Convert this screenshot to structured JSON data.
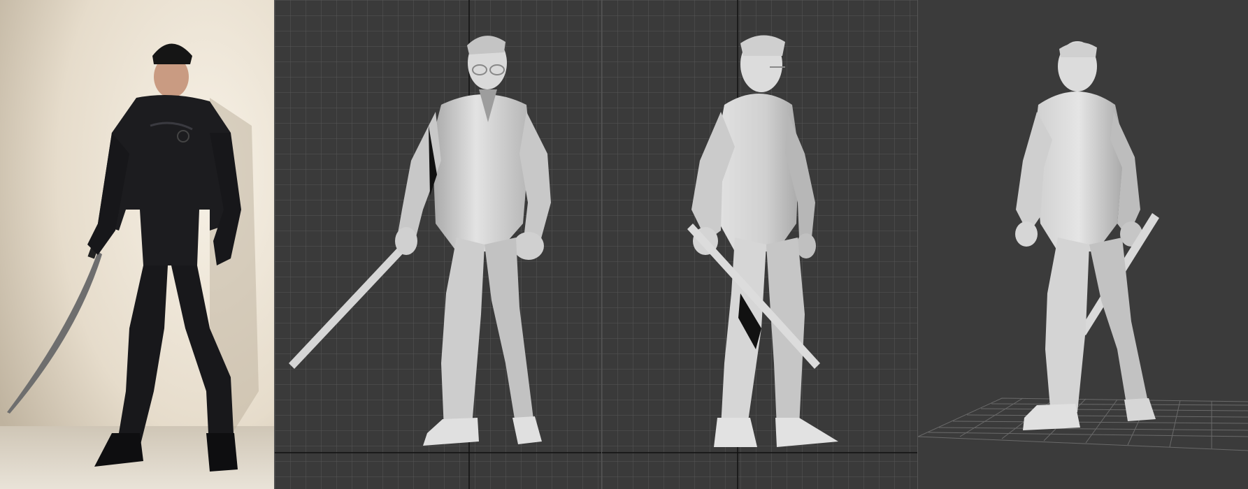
{
  "colors": {
    "viewport_bg": "#3a3a3a",
    "viewport_bg_persp": "#3b3b3b",
    "grid_line": "#575757",
    "grid_axis": "#101010",
    "model_light": "#d9d9d9",
    "model_mid": "#b8b8b8",
    "model_shadow": "#8a8a8a",
    "photo_wall": "#e9e0cf",
    "photo_floor": "#d8d0c2",
    "leather": "#1a1a1c"
  },
  "viewports": [
    {
      "name": "reference-photo"
    },
    {
      "name": "front-viewport"
    },
    {
      "name": "side-viewport"
    },
    {
      "name": "perspective-viewport"
    }
  ]
}
